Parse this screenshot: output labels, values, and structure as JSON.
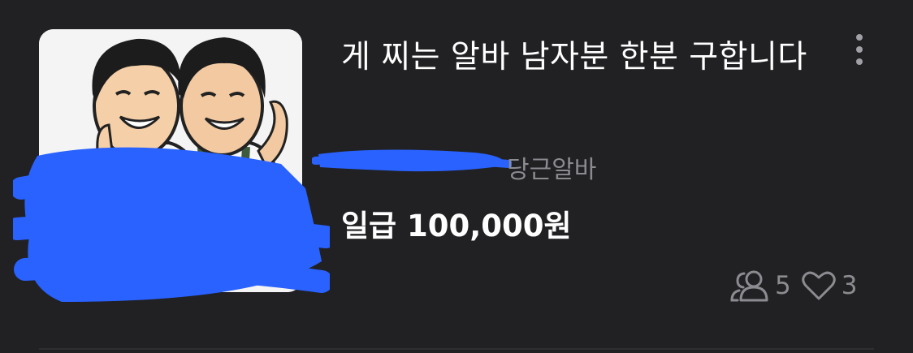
{
  "listing": {
    "title": "게 찌는 알바 남자분 한분 구합니다",
    "source": "당근알바",
    "price": "일급 100,000원",
    "applicants_count": "5",
    "likes_count": "3",
    "icons": {
      "applicants": "people-icon",
      "likes": "heart-icon",
      "more": "more-vertical-icon"
    }
  },
  "colors": {
    "background": "#212124",
    "text_primary": "#ffffff",
    "text_secondary": "#8b8b90",
    "redaction": "#2962ff"
  }
}
